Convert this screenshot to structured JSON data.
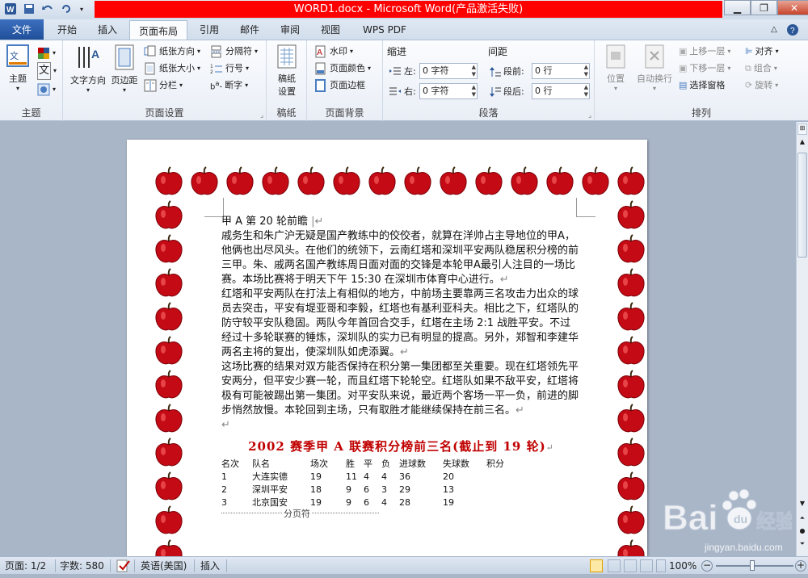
{
  "titlebar": {
    "title": "WORD1.docx - Microsoft Word(产品激活失败)",
    "qat_icons": [
      "word-icon",
      "save-icon",
      "undo-icon",
      "redo-icon",
      "customize-icon"
    ]
  },
  "tabs": [
    {
      "label": "文件",
      "key": "file"
    },
    {
      "label": "开始",
      "key": "home"
    },
    {
      "label": "插入",
      "key": "insert"
    },
    {
      "label": "页面布局",
      "key": "layout"
    },
    {
      "label": "引用",
      "key": "references"
    },
    {
      "label": "邮件",
      "key": "mailings"
    },
    {
      "label": "审阅",
      "key": "review"
    },
    {
      "label": "视图",
      "key": "view"
    },
    {
      "label": "WPS PDF",
      "key": "wpspdf"
    }
  ],
  "ribbon": {
    "theme": {
      "group_label": "主题",
      "theme_btn": "主题"
    },
    "page_setup": {
      "group_label": "页面设置",
      "text_direction": "文字方向",
      "margins": "页边距",
      "orientation": "纸张方向",
      "size": "纸张大小",
      "columns": "分栏",
      "breaks": "分隔符",
      "line_numbers": "行号",
      "hyphenation": "断字"
    },
    "manuscript": {
      "group_label": "稿纸",
      "btn_line1": "稿纸",
      "btn_line2": "设置"
    },
    "page_background": {
      "group_label": "页面背景",
      "watermark": "水印",
      "page_color": "页面颜色",
      "page_borders": "页面边框"
    },
    "paragraph": {
      "group_label": "段落",
      "indent_label": "缩进",
      "spacing_label": "间距",
      "left_label": "左:",
      "left_value": "0 字符",
      "right_label": "右:",
      "right_value": "0 字符",
      "before_label": "段前:",
      "before_value": "0 行",
      "after_label": "段后:",
      "after_value": "0 行"
    },
    "arrange": {
      "group_label": "排列",
      "position": "位置",
      "wrap": "自动换行",
      "bring_forward": "上移一层",
      "send_backward": "下移一层",
      "selection_pane": "选择窗格",
      "align": "对齐",
      "group": "组合",
      "rotate": "旋转"
    }
  },
  "document": {
    "heading": "甲 A 第 20 轮前瞻",
    "paragraphs": [
      "戚务生和朱广沪无疑是国产教练中的佼佼者，就算在洋帅占主导地位的甲A，他俩也出尽风头。在他们的统领下，云南红塔和深圳平安两队稳居积分榜的前三甲。朱、戚两名国产教练周日面对面的交锋是本轮甲A最引人注目的一场比赛。本场比赛将于明天下午 15:30 在深圳市体育中心进行。",
      "红塔和平安两队在打法上有相似的地方，中前场主要靠两三名攻击力出众的球员去突击，平安有堤亚哥和李毅，红塔也有基利亚科夫。相比之下，红塔队的防守较平安队稳固。两队今年首回合交手，红塔在主场 2:1 战胜平安。不过经过十多轮联赛的锤炼，深圳队的实力已有明显的提高。另外，郑智和李建华两名主将的复出，使深圳队如虎添翼。",
      "这场比赛的结果对双方能否保持在积分第一集团都至关重要。现在红塔领先平安两分，但平安少赛一轮，而且红塔下轮轮空。红塔队如果不敌平安，红塔将极有可能被踢出第一集团。对平安队来说，最近两个客场一平一负，前进的脚步悄然放慢。本轮回到主场，只有取胜才能继续保持在前三名。"
    ],
    "table_title": "2002 赛季甲 A 联赛积分榜前三名(截止到 19 轮)",
    "table_header": [
      "名次",
      "队名",
      "场次",
      "胜",
      "平",
      "负",
      "进球数",
      "失球数",
      "积分"
    ],
    "table_rows": [
      [
        "1",
        "大连实德",
        "19",
        "11",
        "4",
        "4",
        "36",
        "20",
        ""
      ],
      [
        "2",
        "深圳平安",
        "18",
        "9",
        "6",
        "3",
        "29",
        "13",
        ""
      ],
      [
        "3",
        "北京国安",
        "19",
        "9",
        "6",
        "4",
        "28",
        "19",
        ""
      ]
    ],
    "page_break_label": "分页符"
  },
  "statusbar": {
    "page": "页面: 1/2",
    "words": "字数: 580",
    "language": "英语(美国)",
    "mode": "插入",
    "zoom": "100%"
  },
  "watermark": {
    "brand": "Bai",
    "brand2": "经验",
    "url": "jingyan.baidu.com"
  },
  "colors": {
    "accent": "#2b5797",
    "title_red": "#ff0000",
    "table_title": "#c00000",
    "apple": "#c40a14"
  }
}
